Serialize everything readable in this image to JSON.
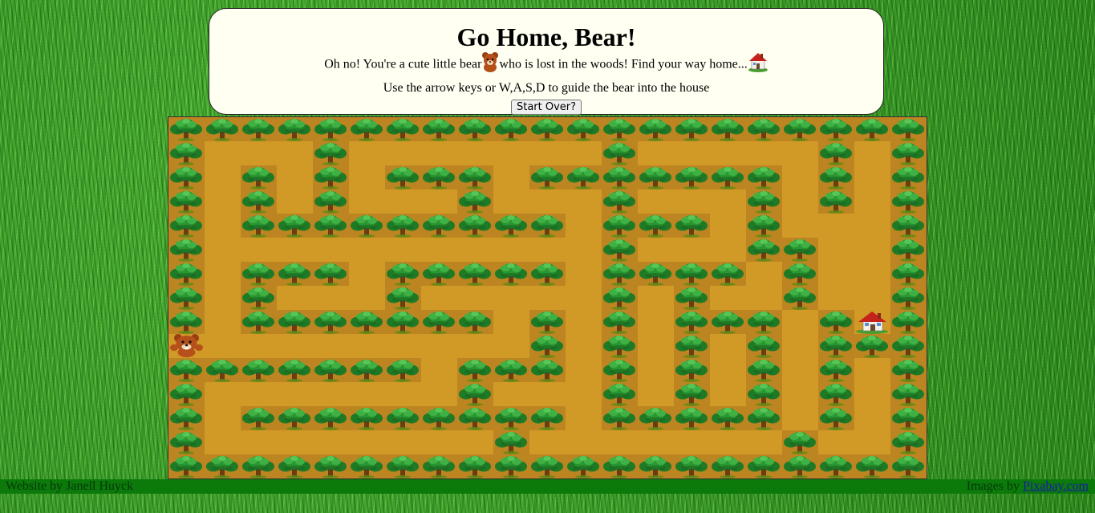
{
  "header": {
    "title": "Go Home, Bear!",
    "intro_before": "Oh no! You're a cute little bear",
    "intro_after": "who is lost in the woods! Find your way home...",
    "instructions": "Use the arrow keys or W,A,S,D to guide the bear into the house",
    "start_over_label": "Start Over?"
  },
  "maze": {
    "rows": 15,
    "cols": 21,
    "grid": [
      "#####################",
      "#...#.......#.....#.#",
      "#.#.#.###.#######.#.#",
      "#.#.#...#...#...#.#.#",
      "#.#########.###.#...#",
      "#...........#...##..#",
      "#.###.#####.####.#..#",
      "#.#...#.....#.#..#..#",
      "#.#######.#.#.###.#H#",
      "B.........#.#.#.#.###",
      "#######.###.#.#.#.#.#",
      "#.......#...#.#.#.#.#",
      "#.#########.#####.#.#",
      "#........#.......#..#",
      "#####################"
    ],
    "wall_color": "#bd8521",
    "path_color": "#d19a26",
    "tree_icon": "tree-icon",
    "bear_icon": "bear-icon",
    "house_icon": "house-icon"
  },
  "footer": {
    "left_text": "Website by Janell Huyck",
    "right_prefix": "Images by ",
    "right_link": "Pixabay.com"
  }
}
